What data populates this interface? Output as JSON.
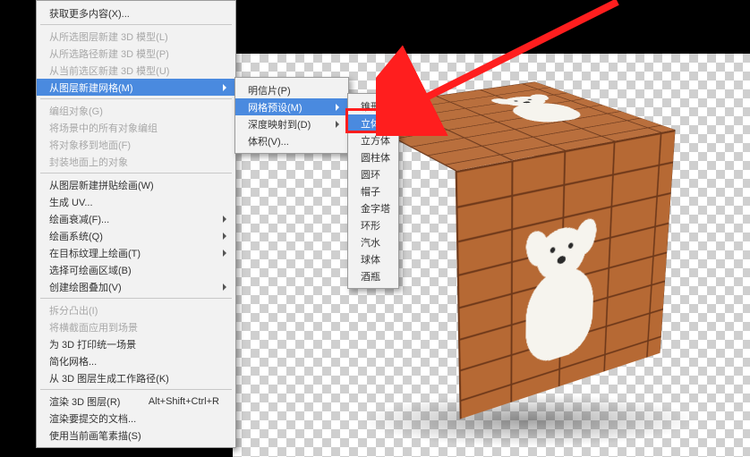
{
  "menu1": {
    "get_more": "获取更多内容(X)...",
    "from_sel_layer": "从所选图层新建 3D 模型(L)",
    "from_sel_path": "从所选路径新建 3D 模型(P)",
    "from_cur_sel": "从当前选区新建 3D 模型(U)",
    "from_layer_mesh": "从图层新建网格(M)",
    "group_objs": "编组对象(G)",
    "group_scene": "将场景中的所有对象编组",
    "move_to_ground": "将对象移到地面(F)",
    "pack_ground": "封装地面上的对象",
    "tile_paint": "从图层新建拼贴绘画(W)",
    "gen_uv": "生成 UV...",
    "paint_falloff": "绘画衰减(F)...",
    "paint_system": "绘画系统(Q)",
    "paint_target_tex": "在目标纹理上绘画(T)",
    "select_paintable": "选择可绘画区域(B)",
    "create_overlay": "创建绘图叠加(V)",
    "split_extrusion": "拆分凸出(I)",
    "apply_section": "将横截面应用到场景",
    "unify_3dprint": "为 3D 打印统一场景",
    "simplify_mesh": "简化网格...",
    "work_path_from_3d": "从 3D 图层生成工作路径(K)",
    "render_3d_layer": "渲染 3D 图层(R)",
    "render_shortcut": "Alt+Shift+Ctrl+R",
    "render_submit": "渲染要提交的文档...",
    "sketch_brush": "使用当前画笔素描(S)"
  },
  "menu2": {
    "postcard": "明信片(P)",
    "mesh_preset": "网格预设(M)",
    "depth_map": "深度映射到(D)",
    "volume": "体积(V)..."
  },
  "menu3": {
    "cone": "锥形",
    "cube_wrap": "立体环绕",
    "cube": "立方体",
    "cylinder": "圆柱体",
    "donut": "圆环",
    "hat": "帽子",
    "pyramid": "金字塔",
    "ring": "环形",
    "soda": "汽水",
    "sphere": "球体",
    "wine": "酒瓶"
  }
}
